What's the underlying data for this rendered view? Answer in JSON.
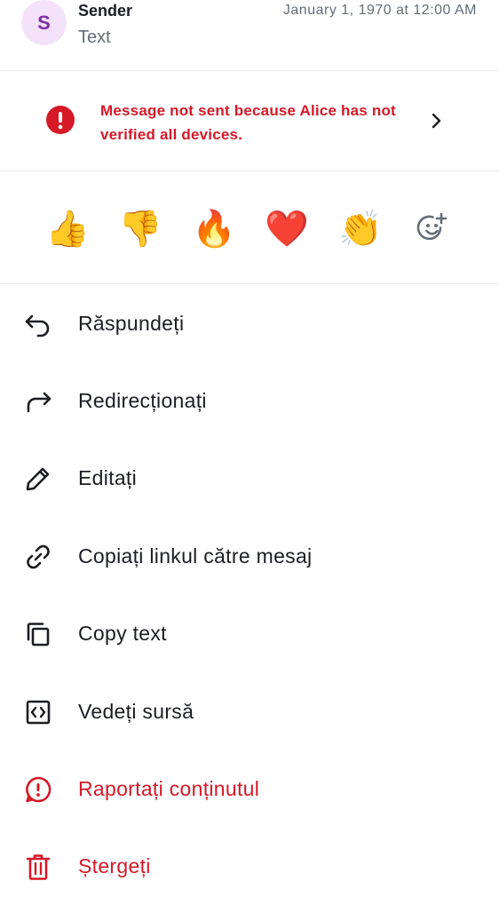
{
  "header": {
    "avatar_letter": "S",
    "sender_name": "Sender",
    "message_text": "Text",
    "timestamp": "January 1, 1970 at 12:00 AM"
  },
  "warning": {
    "text": "Message not sent because Alice has not verified all devices.",
    "icon": "error-icon",
    "chevron_icon": "chevron-right-icon",
    "color": "#d51928"
  },
  "reactions": {
    "items": [
      {
        "emoji": "👍",
        "name": "thumbs-up"
      },
      {
        "emoji": "👎",
        "name": "thumbs-down"
      },
      {
        "emoji": "🔥",
        "name": "fire"
      },
      {
        "emoji": "❤️",
        "name": "heart"
      },
      {
        "emoji": "👏",
        "name": "clapping-hands"
      }
    ],
    "more_icon": "add-reaction-icon"
  },
  "actions": [
    {
      "label": "Răspundeți",
      "icon": "reply-icon",
      "danger": false
    },
    {
      "label": "Redirecționați",
      "icon": "forward-icon",
      "danger": false
    },
    {
      "label": "Editați",
      "icon": "edit-icon",
      "danger": false
    },
    {
      "label": "Copiați linkul către mesaj",
      "icon": "link-icon",
      "danger": false
    },
    {
      "label": "Copy text",
      "icon": "copy-icon",
      "danger": false
    },
    {
      "label": "Vedeți sursă",
      "icon": "view-source-icon",
      "danger": false
    },
    {
      "label": "Raportați conținutul",
      "icon": "report-icon",
      "danger": true
    },
    {
      "label": "Ștergeți",
      "icon": "delete-icon",
      "danger": true
    }
  ],
  "colors": {
    "danger": "#d51928",
    "text_primary": "#1b1d22",
    "text_secondary": "#656d77",
    "divider": "#e6e8eb",
    "avatar_bg": "#f3e2fa",
    "avatar_fg": "#7e2fa1"
  }
}
